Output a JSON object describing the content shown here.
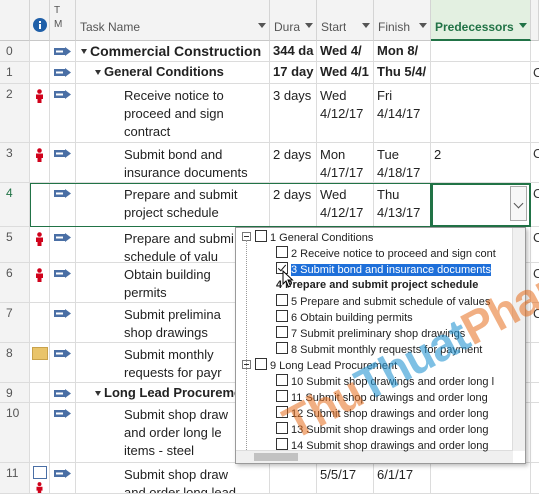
{
  "columns": {
    "row_id": "",
    "info_icon": "info-icon",
    "mode": "T\nM",
    "task_name": "Task Name",
    "duration": "Dura",
    "start": "Start",
    "finish": "Finish",
    "predecessors": "Predecessors"
  },
  "rows": [
    {
      "id": "0",
      "indicator": "",
      "mode": "auto",
      "name": "Commercial Construction",
      "duration": "344 da",
      "start": "Wed 4/",
      "finish": "Mon 8/",
      "pred": "",
      "bold": true,
      "level": 0
    },
    {
      "id": "1",
      "indicator": "",
      "mode": "auto",
      "name": "General Conditions",
      "duration": "17 day",
      "start": "Wed 4/1",
      "finish": "Thu 5/4/",
      "pred": "",
      "bold": true,
      "level": 1
    },
    {
      "id": "2",
      "indicator": "person",
      "mode": "auto",
      "name": "Receive notice to\nproceed and sign\ncontract",
      "duration": "3 days",
      "start": "Wed\n4/12/17",
      "finish": "Fri\n4/14/17",
      "pred": "",
      "bold": false,
      "level": 2
    },
    {
      "id": "3",
      "indicator": "person",
      "mode": "auto",
      "name": "Submit bond and\ninsurance documents",
      "duration": "2 days",
      "start": "Mon\n4/17/17",
      "finish": "Tue\n4/18/17",
      "pred": "2",
      "bold": false,
      "level": 2
    },
    {
      "id": "4",
      "indicator": "",
      "mode": "auto",
      "name": "Prepare and submit\nproject schedule",
      "duration": "2 days",
      "start": "Wed\n4/12/17",
      "finish": "Thu\n4/13/17",
      "pred": "",
      "bold": false,
      "level": 2
    },
    {
      "id": "5",
      "indicator": "person",
      "mode": "auto",
      "name": "Prepare and submi\nschedule of valu",
      "duration": "",
      "start": "",
      "finish": "",
      "pred": "",
      "bold": false,
      "level": 2
    },
    {
      "id": "6",
      "indicator": "person",
      "mode": "auto",
      "name": "Obtain building\npermits",
      "duration": "",
      "start": "",
      "finish": "",
      "pred": "",
      "bold": false,
      "level": 2
    },
    {
      "id": "7",
      "indicator": "",
      "mode": "auto",
      "name": "Submit prelimina\nshop drawings",
      "duration": "",
      "start": "",
      "finish": "",
      "pred": "",
      "bold": false,
      "level": 2
    },
    {
      "id": "8",
      "indicator": "note",
      "mode": "auto",
      "name": "Submit monthly\nrequests for payr",
      "duration": "",
      "start": "",
      "finish": "",
      "pred": "",
      "bold": false,
      "level": 2
    },
    {
      "id": "9",
      "indicator": "",
      "mode": "auto",
      "name": "Long Lead Procuremen",
      "duration": "",
      "start": "",
      "finish": "",
      "pred": "",
      "bold": true,
      "level": 1
    },
    {
      "id": "10",
      "indicator": "",
      "mode": "auto",
      "name": "Submit shop draw\nand order long le\nitems - steel",
      "duration": "",
      "start": "",
      "finish": "",
      "pred": "",
      "bold": false,
      "level": 2
    },
    {
      "id": "11",
      "indicator": "calendar",
      "mode": "auto",
      "name": "Submit shop draw\nand order long lead",
      "duration": "",
      "start": "5/5/17",
      "finish": "6/1/17",
      "pred": "",
      "bold": false,
      "level": 2
    }
  ],
  "tail_letters": [
    "C",
    "C",
    "C",
    "C",
    "C",
    "C"
  ],
  "popup": {
    "items": [
      {
        "text": "1  General Conditions",
        "type": "group",
        "checked": false
      },
      {
        "text": "2  Receive notice to proceed and sign cont",
        "type": "item",
        "checked": false
      },
      {
        "text": "3  Submit bond and insurance documents",
        "type": "item",
        "checked": true,
        "highlight": true
      },
      {
        "text": "4  Prepare and submit project schedule",
        "type": "current",
        "checked": false
      },
      {
        "text": "5  Prepare and submit schedule of values",
        "type": "item",
        "checked": false
      },
      {
        "text": "6  Obtain building permits",
        "type": "item",
        "checked": false
      },
      {
        "text": "7  Submit preliminary shop drawings",
        "type": "item",
        "checked": false
      },
      {
        "text": "8  Submit monthly requests for payment",
        "type": "item",
        "checked": false
      },
      {
        "text": "9  Long Lead Procurement",
        "type": "group",
        "checked": false
      },
      {
        "text": "10  Submit shop drawings and order long l",
        "type": "item",
        "checked": false
      },
      {
        "text": "11  Submit shop drawings and order long",
        "type": "item",
        "checked": false
      },
      {
        "text": "12  Submit shop drawings and order long",
        "type": "item",
        "checked": false
      },
      {
        "text": "13  Submit shop drawings and order long",
        "type": "item",
        "checked": false
      },
      {
        "text": "14  Submit shop drawings and order long",
        "type": "item",
        "checked": false
      }
    ]
  },
  "watermark": {
    "part1": "Thu",
    "part2": "Thuat",
    "part3": "Phan Mem"
  },
  "colors": {
    "accent": "#217346",
    "highlight": "#1e6fd9",
    "info": "#1f5fa8",
    "person": "#d0021b",
    "mode_icon": "#4a6fa5"
  }
}
